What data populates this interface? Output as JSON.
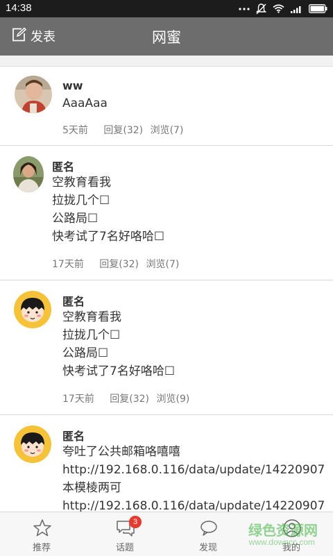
{
  "status_bar": {
    "time": "14:38"
  },
  "header": {
    "post_label": "发表",
    "title": "网蜜"
  },
  "posts": [
    {
      "author": "ww",
      "lines": [
        "AaaAaa"
      ],
      "time": "5天前",
      "replies": "回复(32)",
      "views": "浏览(7)"
    },
    {
      "author": "匿名",
      "lines": [
        "空教育看我",
        "拉拢几个☐",
        "公路局☐",
        "快考试了7名好咯哈☐"
      ],
      "time": "17天前",
      "replies": "回复(32)",
      "views": "浏览(7)"
    },
    {
      "author": "匿名",
      "lines": [
        "空教育看我",
        "拉拢几个☐",
        "公路局☐",
        "快考试了7名好咯哈☐"
      ],
      "time": "17天前",
      "replies": "回复(32)",
      "views": "浏览(9)"
    },
    {
      "author": "匿名",
      "lines": [
        "夸吐了公共邮箱咯嘻嘻",
        "http://192.168.0.116/data/update/14220907",
        "本模棱两可",
        "http://192.168.0.116/data/update/14220907"
      ],
      "time": "",
      "replies": "",
      "views": ""
    }
  ],
  "bottom_nav": {
    "items": [
      {
        "label": "推荐",
        "icon": "star-icon"
      },
      {
        "label": "话题",
        "icon": "chat-bubbles-icon",
        "badge": "3"
      },
      {
        "label": "发现",
        "icon": "speech-bubble-icon"
      },
      {
        "label": "我的",
        "icon": "person-icon"
      }
    ]
  },
  "watermark": {
    "text": "绿色资源网",
    "sub": "www.downcc.com"
  },
  "colors": {
    "status_bar": "#1c1c1c",
    "title_bar": "#6d6d6d",
    "badge": "#e8382f"
  }
}
